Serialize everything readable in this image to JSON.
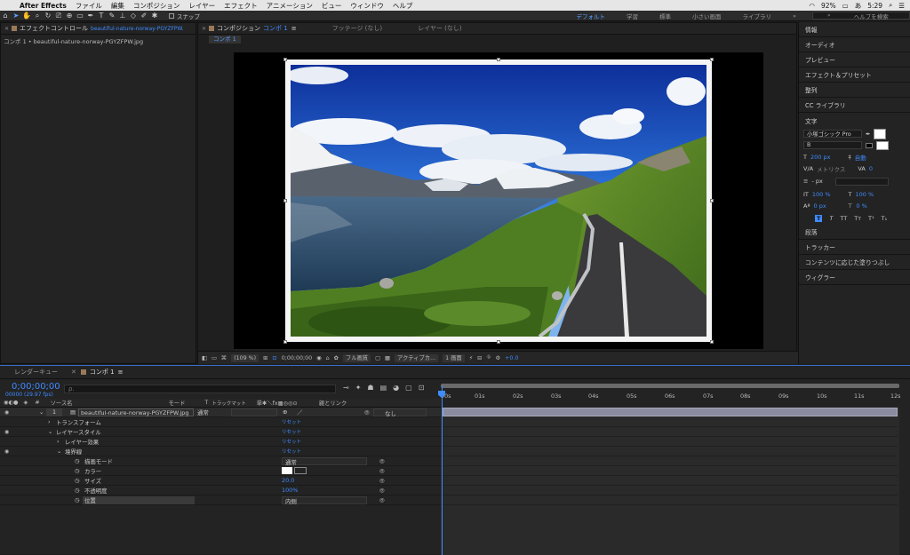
{
  "menubar": {
    "app": "After Effects",
    "items": [
      "ファイル",
      "編集",
      "コンポジション",
      "レイヤー",
      "エフェクト",
      "アニメーション",
      "ビュー",
      "ウィンドウ",
      "ヘルプ"
    ],
    "battery": "92%",
    "input": "あ",
    "time": "5:29"
  },
  "toolbar": {
    "snap_label": "スナップ",
    "workspaces": [
      "デフォルト",
      "学習",
      "標準",
      "小さい画面",
      "ライブラリ"
    ],
    "search_placeholder": "ヘルプを検索"
  },
  "effects_panel": {
    "tab_label": "エフェクトコントロール",
    "tab_file": "beautiful-nature-norway-PGYZFPW.",
    "content": "コンポ 1 • beautiful-nature-norway-PGYZFPW.jpg"
  },
  "comp_panel": {
    "tab_label": "コンポジション",
    "tab_comp": "コンポ 1",
    "footage_tab": "フッテージ (なし)",
    "layer_tab": "レイヤー (なし)",
    "subtab": "コンポ 1",
    "footer": {
      "zoom": "(109 %)",
      "time": "0;00;00;00",
      "quality": "フル画質",
      "camera": "アクティブカ...",
      "view": "1 画面",
      "exposure": "+0.0"
    }
  },
  "right_panel": {
    "items_top": [
      "情報",
      "オーディオ",
      "プレビュー",
      "エフェクト＆プリセット",
      "整列",
      "CC ライブラリ"
    ],
    "char_title": "文字",
    "font": "小塚ゴシック Pro",
    "style": "B",
    "size": "200 px",
    "leading": "自動",
    "tracking_label": "メトリクス",
    "tracking_val": "0",
    "stroke": "- px",
    "vscale": "100 %",
    "hscale": "100 %",
    "baseline": "0 px",
    "tsume": "0 %",
    "typo_buttons": [
      "T",
      "T",
      "TT",
      "Tт",
      "T¹",
      "T₁"
    ],
    "items_bottom": [
      "段落",
      "トラッカー",
      "コンテンツに応じた塗りつぶし",
      "ウィグラー"
    ]
  },
  "timeline": {
    "tab_render": "レンダーキュー",
    "tab_comp": "コンポ 1",
    "timecode": "0;00;00;00",
    "fps": "00000 (29.97 fps)",
    "search_placeholder": "ρ.",
    "columns": {
      "num": "#",
      "source": "ソース名",
      "mode": "モード",
      "t": "T",
      "trkmat": "トラックマット",
      "switches": "単✱＼fx▦◎◎⊙",
      "parent": "親とリンク"
    },
    "layer": {
      "num": "1",
      "name": "beautiful-nature-norway-PGYZFPW.jpg",
      "mode": "通常",
      "parent": "なし"
    },
    "props": [
      {
        "label": "トランスフォーム",
        "value": "リセット",
        "indent": 1
      },
      {
        "label": "レイヤースタイル",
        "value": "リセット",
        "indent": 1
      },
      {
        "label": "レイヤー効果",
        "value": "リセット",
        "indent": 2
      },
      {
        "label": "境界線",
        "value": "リセット",
        "indent": 2
      },
      {
        "label": "描画モード",
        "value": "通常",
        "indent": 3
      },
      {
        "label": "カラー",
        "value": "",
        "indent": 3
      },
      {
        "label": "サイズ",
        "value": "20.0",
        "indent": 3
      },
      {
        "label": "不透明度",
        "value": "100%",
        "indent": 3
      },
      {
        "label": "位置",
        "value": "内側",
        "indent": 3
      }
    ],
    "ruler_ticks": [
      "00s",
      "01s",
      "02s",
      "03s",
      "04s",
      "05s",
      "06s",
      "07s",
      "08s",
      "09s",
      "10s",
      "11s",
      "12s"
    ]
  },
  "colors": {
    "accent": "#3f8bff",
    "panel": "#232323",
    "layer_bar": "#8a8ca0"
  }
}
